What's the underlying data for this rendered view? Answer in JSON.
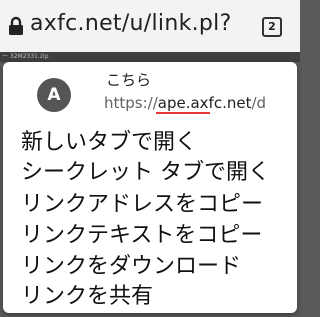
{
  "address_bar": {
    "url": "axfc.net/u/link.pl?",
    "tab_count": "2",
    "lock_icon": "lock-icon"
  },
  "page": {
    "strip_text": "ー 32M2331.zip"
  },
  "context_menu": {
    "avatar_letter": "A",
    "title": "こちら",
    "url_prefix": "https://",
    "url_domain": "ape.axfc.net",
    "url_suffix": "/d",
    "underline_color": "#e53935",
    "items": [
      "新しいタブで開く",
      "シークレット タブで開く",
      "リンクアドレスをコピー",
      "リンクテキストをコピー",
      "リンクをダウンロード",
      "リンクを共有"
    ]
  }
}
